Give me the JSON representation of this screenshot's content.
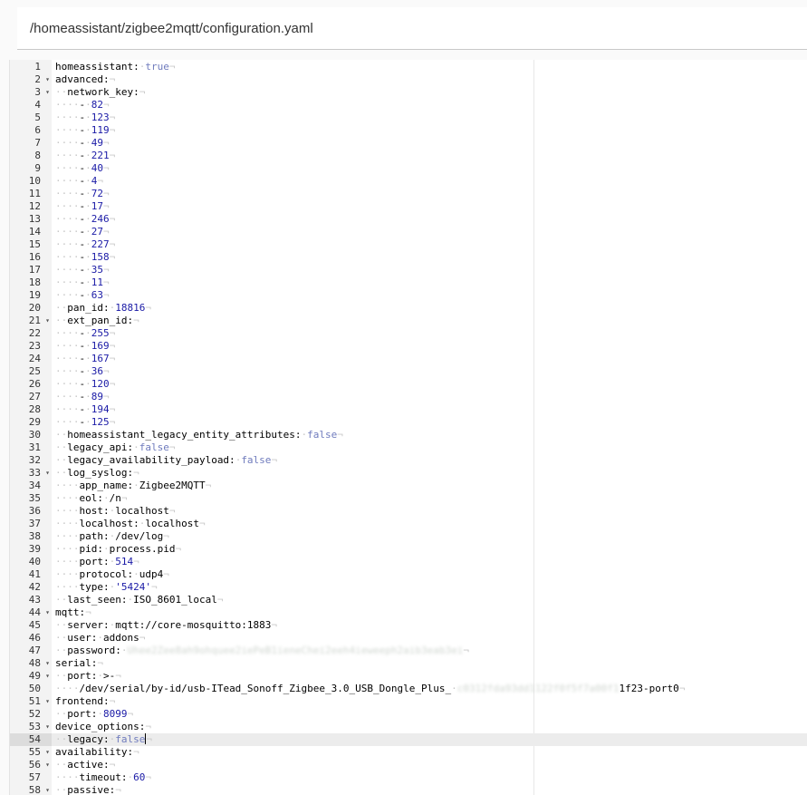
{
  "header": {
    "file_path": "/homeassistant/zigbee2mqtt/configuration.yaml"
  },
  "editor": {
    "active_line": 54,
    "lines": [
      {
        "n": 1,
        "fold": false,
        "ind": "",
        "key": "homeassistant:",
        "val": "true",
        "vt": "b"
      },
      {
        "n": 2,
        "fold": true,
        "ind": "",
        "key": "advanced:",
        "val": "",
        "vt": ""
      },
      {
        "n": 3,
        "fold": true,
        "ind": "··",
        "key": "network_key:",
        "val": "",
        "vt": ""
      },
      {
        "n": 4,
        "fold": false,
        "ind": "····",
        "key": "-",
        "val": "82",
        "vt": "v"
      },
      {
        "n": 5,
        "fold": false,
        "ind": "····",
        "key": "-",
        "val": "123",
        "vt": "v"
      },
      {
        "n": 6,
        "fold": false,
        "ind": "····",
        "key": "-",
        "val": "119",
        "vt": "v"
      },
      {
        "n": 7,
        "fold": false,
        "ind": "····",
        "key": "-",
        "val": "49",
        "vt": "v"
      },
      {
        "n": 8,
        "fold": false,
        "ind": "····",
        "key": "-",
        "val": "221",
        "vt": "v"
      },
      {
        "n": 9,
        "fold": false,
        "ind": "····",
        "key": "-",
        "val": "40",
        "vt": "v"
      },
      {
        "n": 10,
        "fold": false,
        "ind": "····",
        "key": "-",
        "val": "4",
        "vt": "v"
      },
      {
        "n": 11,
        "fold": false,
        "ind": "····",
        "key": "-",
        "val": "72",
        "vt": "v"
      },
      {
        "n": 12,
        "fold": false,
        "ind": "····",
        "key": "-",
        "val": "17",
        "vt": "v"
      },
      {
        "n": 13,
        "fold": false,
        "ind": "····",
        "key": "-",
        "val": "246",
        "vt": "v"
      },
      {
        "n": 14,
        "fold": false,
        "ind": "····",
        "key": "-",
        "val": "27",
        "vt": "v"
      },
      {
        "n": 15,
        "fold": false,
        "ind": "····",
        "key": "-",
        "val": "227",
        "vt": "v"
      },
      {
        "n": 16,
        "fold": false,
        "ind": "····",
        "key": "-",
        "val": "158",
        "vt": "v"
      },
      {
        "n": 17,
        "fold": false,
        "ind": "····",
        "key": "-",
        "val": "35",
        "vt": "v"
      },
      {
        "n": 18,
        "fold": false,
        "ind": "····",
        "key": "-",
        "val": "11",
        "vt": "v"
      },
      {
        "n": 19,
        "fold": false,
        "ind": "····",
        "key": "-",
        "val": "63",
        "vt": "v"
      },
      {
        "n": 20,
        "fold": false,
        "ind": "··",
        "key": "pan_id:",
        "val": "18816",
        "vt": "v"
      },
      {
        "n": 21,
        "fold": true,
        "ind": "··",
        "key": "ext_pan_id:",
        "val": "",
        "vt": ""
      },
      {
        "n": 22,
        "fold": false,
        "ind": "····",
        "key": "-",
        "val": "255",
        "vt": "v"
      },
      {
        "n": 23,
        "fold": false,
        "ind": "····",
        "key": "-",
        "val": "169",
        "vt": "v"
      },
      {
        "n": 24,
        "fold": false,
        "ind": "····",
        "key": "-",
        "val": "167",
        "vt": "v"
      },
      {
        "n": 25,
        "fold": false,
        "ind": "····",
        "key": "-",
        "val": "36",
        "vt": "v"
      },
      {
        "n": 26,
        "fold": false,
        "ind": "····",
        "key": "-",
        "val": "120",
        "vt": "v"
      },
      {
        "n": 27,
        "fold": false,
        "ind": "····",
        "key": "-",
        "val": "89",
        "vt": "v"
      },
      {
        "n": 28,
        "fold": false,
        "ind": "····",
        "key": "-",
        "val": "194",
        "vt": "v"
      },
      {
        "n": 29,
        "fold": false,
        "ind": "····",
        "key": "-",
        "val": "125",
        "vt": "v"
      },
      {
        "n": 30,
        "fold": false,
        "ind": "··",
        "key": "homeassistant_legacy_entity_attributes:",
        "val": "false",
        "vt": "b"
      },
      {
        "n": 31,
        "fold": false,
        "ind": "··",
        "key": "legacy_api:",
        "val": "false",
        "vt": "b"
      },
      {
        "n": 32,
        "fold": false,
        "ind": "··",
        "key": "legacy_availability_payload:",
        "val": "false",
        "vt": "b"
      },
      {
        "n": 33,
        "fold": true,
        "ind": "··",
        "key": "log_syslog:",
        "val": "",
        "vt": ""
      },
      {
        "n": 34,
        "fold": false,
        "ind": "····",
        "key": "app_name:",
        "val": "Zigbee2MQTT",
        "vt": "k"
      },
      {
        "n": 35,
        "fold": false,
        "ind": "····",
        "key": "eol:",
        "val": "/n",
        "vt": "k"
      },
      {
        "n": 36,
        "fold": false,
        "ind": "····",
        "key": "host:",
        "val": "localhost",
        "vt": "k"
      },
      {
        "n": 37,
        "fold": false,
        "ind": "····",
        "key": "localhost:",
        "val": "localhost",
        "vt": "k"
      },
      {
        "n": 38,
        "fold": false,
        "ind": "····",
        "key": "path:",
        "val": "/dev/log",
        "vt": "k"
      },
      {
        "n": 39,
        "fold": false,
        "ind": "····",
        "key": "pid:",
        "val": "process.pid",
        "vt": "k"
      },
      {
        "n": 40,
        "fold": false,
        "ind": "····",
        "key": "port:",
        "val": "514",
        "vt": "v"
      },
      {
        "n": 41,
        "fold": false,
        "ind": "····",
        "key": "protocol:",
        "val": "udp4",
        "vt": "k"
      },
      {
        "n": 42,
        "fold": false,
        "ind": "····",
        "key": "type:",
        "val": "'5424'",
        "vt": "s"
      },
      {
        "n": 43,
        "fold": false,
        "ind": "··",
        "key": "last_seen:",
        "val": "ISO_8601_local",
        "vt": "k"
      },
      {
        "n": 44,
        "fold": true,
        "ind": "",
        "key": "mqtt:",
        "val": "",
        "vt": ""
      },
      {
        "n": 45,
        "fold": false,
        "ind": "··",
        "key": "server:",
        "val": "mqtt://core-mosquitto:1883",
        "vt": "k"
      },
      {
        "n": 46,
        "fold": false,
        "ind": "··",
        "key": "user:",
        "val": "addons",
        "vt": "k"
      },
      {
        "n": 47,
        "fold": false,
        "ind": "··",
        "key": "password:",
        "val": "Uhee2Zee8ah9ohquee2iePeB1ieneChei2eeh4ieweeph2aib3eab3ei",
        "vt": "blur"
      },
      {
        "n": 48,
        "fold": true,
        "ind": "",
        "key": "serial:",
        "val": "",
        "vt": ""
      },
      {
        "n": 49,
        "fold": true,
        "ind": "··",
        "key": "port:",
        "val": ">-",
        "vt": "k"
      },
      {
        "n": 50,
        "fold": false,
        "ind": "····",
        "key": "/dev/serial/by-id/usb-ITead_Sonoff_Zigbee_3.0_USB_Dongle_Plus_",
        "val": "c0312fda93dd1122f0f5f7a00f1",
        "vt": "blur",
        "tail": "1f23-port0"
      },
      {
        "n": 51,
        "fold": true,
        "ind": "",
        "key": "frontend:",
        "val": "",
        "vt": ""
      },
      {
        "n": 52,
        "fold": false,
        "ind": "··",
        "key": "port:",
        "val": "8099",
        "vt": "v"
      },
      {
        "n": 53,
        "fold": true,
        "ind": "",
        "key": "device_options:",
        "val": "",
        "vt": ""
      },
      {
        "n": 54,
        "fold": false,
        "ind": "··",
        "key": "legacy:",
        "val": "false",
        "vt": "b",
        "cursor": true
      },
      {
        "n": 55,
        "fold": true,
        "ind": "",
        "key": "availability:",
        "val": "",
        "vt": ""
      },
      {
        "n": 56,
        "fold": true,
        "ind": "··",
        "key": "active:",
        "val": "",
        "vt": ""
      },
      {
        "n": 57,
        "fold": false,
        "ind": "····",
        "key": "timeout:",
        "val": "60",
        "vt": "v"
      },
      {
        "n": 58,
        "fold": true,
        "ind": "··",
        "key": "passive:",
        "val": "",
        "vt": ""
      }
    ]
  }
}
